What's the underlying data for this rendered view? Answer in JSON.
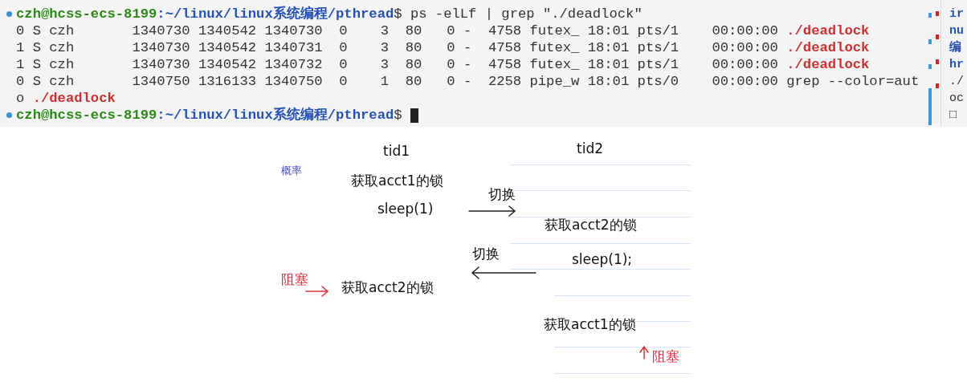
{
  "terminal": {
    "lines": [
      {
        "marker": true,
        "segments": [
          {
            "text": "czh@hcss-ecs-8199",
            "kind": "user"
          },
          {
            "text": ":~/linux/linux系统编程/pthread",
            "kind": "path"
          },
          {
            "text": "$ ps -elLf | grep \"./deadlock\"",
            "kind": "text"
          }
        ]
      },
      {
        "marker": false,
        "segments": [
          {
            "text": "0 S czh       1340730 1340542 1340730  0    3  80   0 -  4758 futex_ 18:01 pts/1    00:00:00 ",
            "kind": "text"
          },
          {
            "text": "./deadlock",
            "kind": "match"
          }
        ]
      },
      {
        "marker": false,
        "segments": [
          {
            "text": "1 S czh       1340730 1340542 1340731  0    3  80   0 -  4758 futex_ 18:01 pts/1    00:00:00 ",
            "kind": "text"
          },
          {
            "text": "./deadlock",
            "kind": "match"
          }
        ]
      },
      {
        "marker": false,
        "segments": [
          {
            "text": "1 S czh       1340730 1340542 1340732  0    3  80   0 -  4758 futex_ 18:01 pts/1    00:00:00 ",
            "kind": "text"
          },
          {
            "text": "./deadlock",
            "kind": "match"
          }
        ]
      },
      {
        "marker": false,
        "segments": [
          {
            "text": "0 S czh       1340750 1316133 1340750  0    1  80   0 -  2258 pipe_w 18:01 pts/0    00:00:00 grep --color=aut",
            "kind": "text"
          }
        ]
      },
      {
        "marker": false,
        "segments": [
          {
            "text": "o ",
            "kind": "text"
          },
          {
            "text": "./deadlock",
            "kind": "match"
          }
        ]
      },
      {
        "marker": true,
        "cursor": true,
        "segments": [
          {
            "text": "czh@hcss-ecs-8199",
            "kind": "user"
          },
          {
            "text": ":~/linux/linux系统编程/pthread",
            "kind": "path"
          },
          {
            "text": "$ ",
            "kind": "text"
          }
        ]
      }
    ]
  },
  "side_pane": {
    "lines": [
      {
        "text": "ir",
        "kind": "keyword"
      },
      {
        "text": "nu",
        "kind": "keyword"
      },
      {
        "text": "编",
        "kind": "keyword"
      },
      {
        "text": "hr",
        "kind": "keyword"
      },
      {
        "text": "./",
        "kind": "text"
      },
      {
        "text": "oc",
        "kind": "text"
      },
      {
        "text": "□",
        "kind": "text"
      }
    ]
  },
  "note": {
    "items": [
      {
        "text": "概率",
        "kind": "label"
      },
      {
        "text": "tid1",
        "kind": "heading"
      },
      {
        "text": "tid2",
        "kind": "heading"
      },
      {
        "text": "获取acct1的锁",
        "kind": "step"
      },
      {
        "text": "sleep(1)",
        "kind": "step"
      },
      {
        "text": "切换",
        "kind": "switch"
      },
      {
        "text": "获取acct2的锁",
        "kind": "step"
      },
      {
        "text": "切换",
        "kind": "switch"
      },
      {
        "text": "sleep(1);",
        "kind": "step"
      },
      {
        "text": "阻塞",
        "kind": "blocked"
      },
      {
        "text": "获取acct2的锁",
        "kind": "step"
      },
      {
        "text": "获取acct1的锁",
        "kind": "step"
      },
      {
        "text": "阻塞",
        "kind": "blocked"
      }
    ]
  }
}
